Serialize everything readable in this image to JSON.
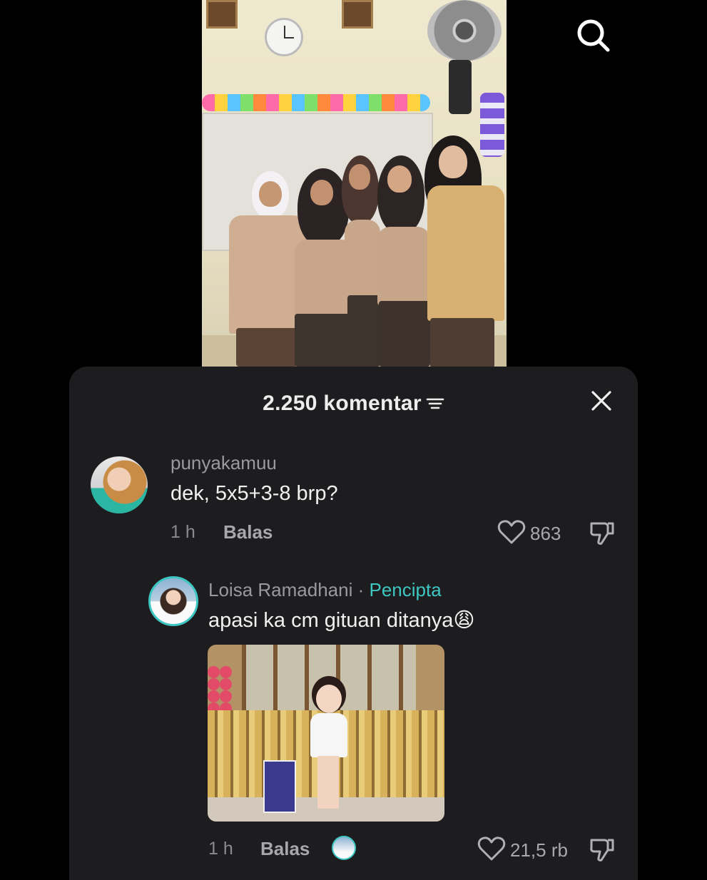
{
  "search": {
    "icon": "search-icon"
  },
  "comments_sheet": {
    "count_label": "2.250 komentar",
    "filter_icon": "filter-icon",
    "close_icon": "close-icon"
  },
  "comments": [
    {
      "username": "punyakamuu",
      "text": "dek, 5x5+3-8 brp?",
      "time": "1 h",
      "reply_label": "Balas",
      "likes": "863"
    }
  ],
  "reply": {
    "username": "Loisa Ramadhani",
    "separator": "·",
    "badge": "Pencipta",
    "text": "apasi ka cm gituan ditanya😩",
    "time": "1 h",
    "reply_label": "Balas",
    "likes": "21,5 rb"
  },
  "colors": {
    "sheet_bg": "#1d1d1f",
    "creator_accent": "#3ec7c2",
    "muted_text": "#9a9a9c"
  }
}
